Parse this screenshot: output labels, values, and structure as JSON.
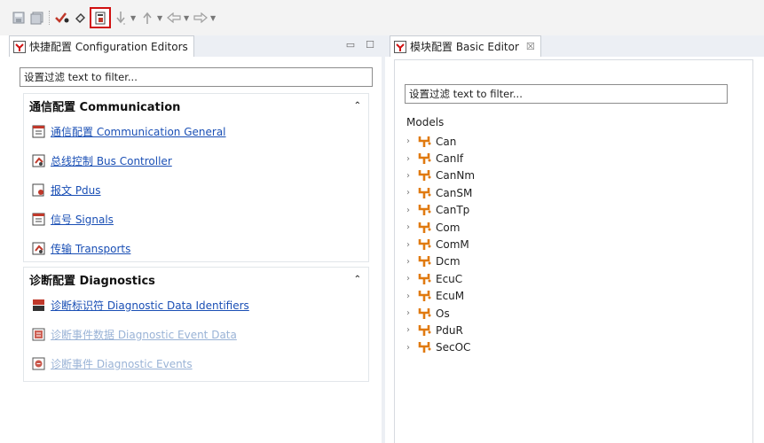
{
  "left_panel": {
    "tab_title": "快捷配置 Configuration Editors",
    "filter_placeholder": "设置过滤 text to filter...",
    "sections": [
      {
        "title": "通信配置 Communication",
        "items": [
          {
            "label": "通信配置 Communication General",
            "icon": "table-icon"
          },
          {
            "label": "总线控制 Bus Controller",
            "icon": "controller-icon"
          },
          {
            "label": "报文 Pdus",
            "icon": "pdu-icon"
          },
          {
            "label": "信号 Signals",
            "icon": "table-icon"
          },
          {
            "label": "传输 Transports",
            "icon": "controller-icon"
          }
        ]
      },
      {
        "title": "诊断配置 Diagnostics",
        "items": [
          {
            "label": "诊断标识符 Diagnostic Data Identifiers",
            "icon": "did-icon",
            "enabled": true
          },
          {
            "label": "诊断事件数据 Diagnostic Event Data",
            "icon": "event-data-icon",
            "enabled": false
          },
          {
            "label": "诊断事件 Diagnostic Events",
            "icon": "event-icon",
            "enabled": false
          }
        ]
      }
    ]
  },
  "right_panel": {
    "tab_title": "模块配置 Basic Editor",
    "tab_close": "☒",
    "filter_placeholder": "设置过滤 text to filter...",
    "models_label": "Models",
    "models": [
      "Can",
      "CanIf",
      "CanNm",
      "CanSM",
      "CanTp",
      "Com",
      "ComM",
      "Dcm",
      "EcuC",
      "EcuM",
      "Os",
      "PduR",
      "SecOC"
    ]
  },
  "colors": {
    "link": "#1a4fb5",
    "link_disabled": "#9ab3d6",
    "module_icon": "#e07a10",
    "highlight_border": "#d01010"
  }
}
